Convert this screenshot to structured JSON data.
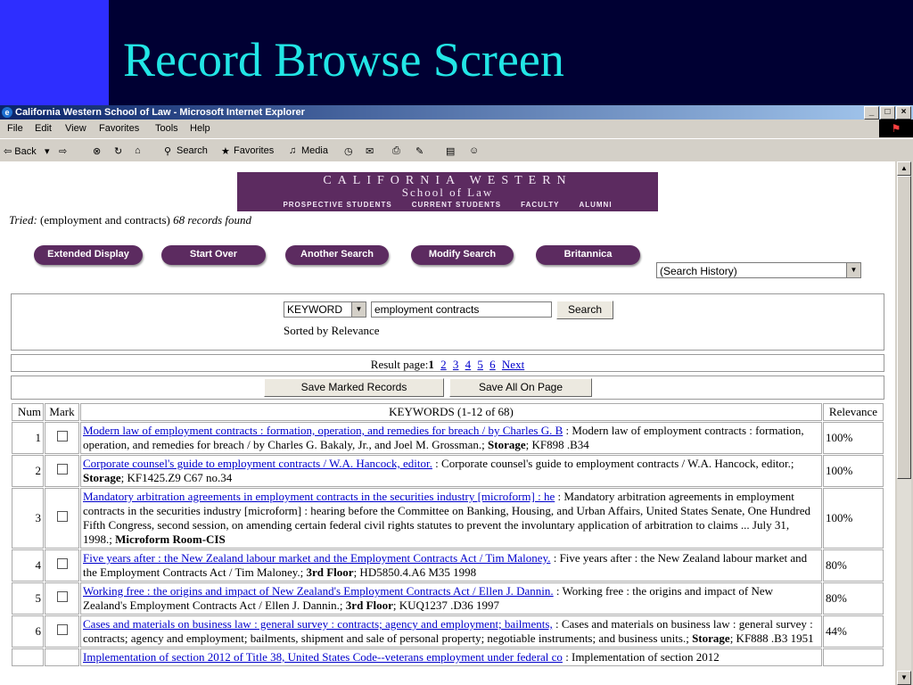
{
  "slide": {
    "title": "Record Browse Screen"
  },
  "window": {
    "title": "California Western School of Law - Microsoft Internet Explorer",
    "controls": [
      "_",
      "□",
      "×"
    ]
  },
  "menu": [
    "File",
    "Edit",
    "View",
    "Favorites",
    "Tools",
    "Help"
  ],
  "toolbar": {
    "back": "⇦ Back",
    "forward": "⇨",
    "search": "Search",
    "favorites": "Favorites",
    "media": "Media"
  },
  "banner": {
    "line1": "CALIFORNIA WESTERN",
    "line2": "School of Law",
    "nav": [
      "PROSPECTIVE STUDENTS",
      "CURRENT STUDENTS",
      "FACULTY",
      "ALUMNI"
    ]
  },
  "tried": {
    "label": "Tried:",
    "query": "(employment and contracts)",
    "found": "68 records found"
  },
  "buttons": {
    "extended": "Extended Display",
    "start_over": "Start Over",
    "another": "Another Search",
    "modify": "Modify Search",
    "britannica": "Britannica"
  },
  "history": {
    "value": "(Search History)"
  },
  "search": {
    "type": "KEYWORD",
    "value": "employment contracts",
    "button": "Search",
    "sorted": "Sorted by Relevance"
  },
  "result_page": {
    "label": "Result page:",
    "current": "1",
    "pages": [
      "2",
      "3",
      "4",
      "5",
      "6"
    ],
    "next": "Next"
  },
  "actions": {
    "save_marked": "Save Marked Records",
    "save_all": "Save All On Page"
  },
  "table": {
    "headers": {
      "num": "Num",
      "mark": "Mark",
      "keywords": "KEYWORDS (1-12 of 68)",
      "relevance": "Relevance"
    },
    "rows": [
      {
        "num": "1",
        "link": "Modern law of employment contracts : formation, operation, and remedies for breach / by Charles G. B",
        "desc": " : Modern law of employment contracts : formation, operation, and remedies for breach / by Charles G. Bakaly, Jr., and Joel M. Grossman.; ",
        "loc": "Storage",
        "call": "; KF898 .B34",
        "rel": "100%"
      },
      {
        "num": "2",
        "link": "Corporate counsel's guide to employment contracts / W.A. Hancock, editor.",
        "desc": " : Corporate counsel's guide to employment contracts / W.A. Hancock, editor.; ",
        "loc": "Storage",
        "call": "; KF1425.Z9 C67 no.34",
        "rel": "100%"
      },
      {
        "num": "3",
        "link": "Mandatory arbitration agreements in employment contracts in the securities industry [microform] : he",
        "desc": " : Mandatory arbitration agreements in employment contracts in the securities industry [microform] : hearing before the Committee on Banking, Housing, and Urban Affairs, United States Senate, One Hundred Fifth Congress, second session, on amending certain federal civil rights statutes to prevent the involuntary application of arbitration to claims ... July 31, 1998.; ",
        "loc": "Microform Room-CIS",
        "call": "",
        "rel": "100%"
      },
      {
        "num": "4",
        "link": "Five years after : the New Zealand labour market and the Employment Contracts Act / Tim Maloney.",
        "desc": " : Five years after : the New Zealand labour market and the Employment Contracts Act / Tim Maloney.; ",
        "loc": "3rd Floor",
        "call": "; HD5850.4.A6 M35 1998",
        "rel": "80%"
      },
      {
        "num": "5",
        "link": "Working free : the origins and impact of New Zealand's Employment Contracts Act / Ellen J. Dannin.",
        "desc": " : Working free : the origins and impact of New Zealand's Employment Contracts Act / Ellen J. Dannin.; ",
        "loc": "3rd Floor",
        "call": "; KUQ1237 .D36 1997",
        "rel": "80%"
      },
      {
        "num": "6",
        "link": "Cases and materials on business law : general survey : contracts; agency and employment; bailments,",
        "desc": " : Cases and materials on business law : general survey : contracts; agency and employment; bailments, shipment and sale of personal property; negotiable instruments; and business units.; ",
        "loc": "Storage",
        "call": "; KF888 .B3 1951",
        "rel": "44%"
      },
      {
        "num": "",
        "link": "Implementation of section 2012 of Title 38, United States Code--veterans employment under federal co",
        "desc": " : Implementation of section 2012",
        "loc": "",
        "call": "",
        "rel": ""
      }
    ]
  }
}
